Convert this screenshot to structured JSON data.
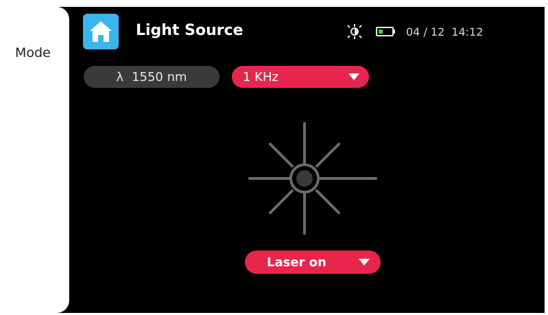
{
  "sidebar": {
    "mode_label": "Mode"
  },
  "header": {
    "title": "Light Source",
    "date": "04 / 12",
    "time": "14:12"
  },
  "controls": {
    "wavelength_symbol": "λ",
    "wavelength_value": "1550 nm",
    "frequency_value": "1 KHz",
    "laser_button_label": "Laser on"
  },
  "colors": {
    "accent": "#e8264d",
    "home_button": "#3ab6ee",
    "background": "#000000",
    "pill_dark": "#3a3a3a"
  },
  "icons": {
    "home": "home-icon",
    "brightness": "brightness-icon",
    "battery": "battery-icon",
    "laser": "laser-indicator-icon",
    "dropdown": "triangle-down-icon"
  }
}
